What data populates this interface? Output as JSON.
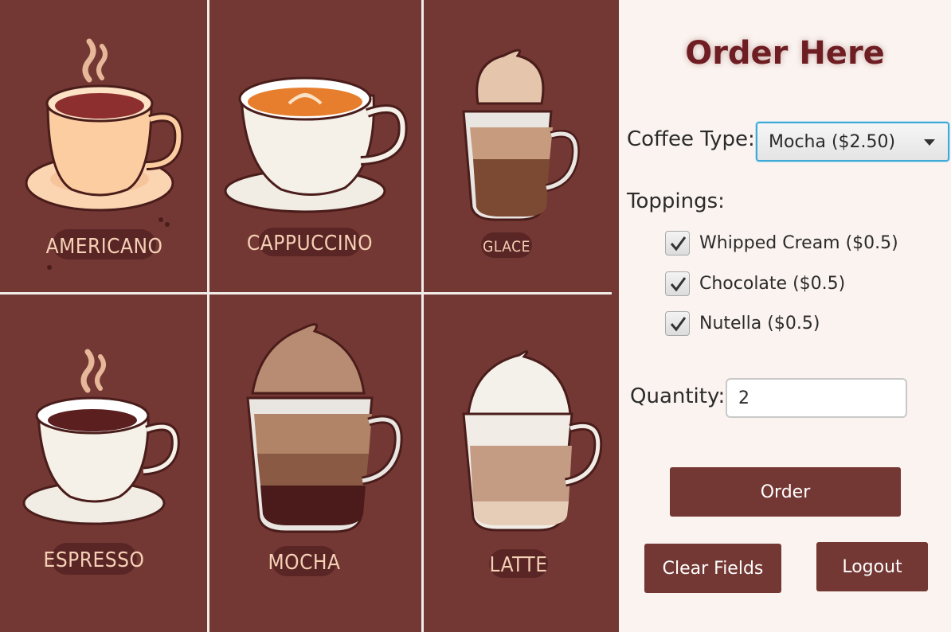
{
  "gallery": {
    "tiles": [
      {
        "name": "Americano",
        "label": "AMERICANO"
      },
      {
        "name": "Cappuccino",
        "label": "CAPPUCCINO"
      },
      {
        "name": "Glace",
        "label": "GLACE"
      },
      {
        "name": "Espresso",
        "label": "ESPRESSO"
      },
      {
        "name": "Mocha",
        "label": "MOCHA"
      },
      {
        "name": "Latte",
        "label": "LATTE"
      }
    ],
    "colors": {
      "background": "#743834",
      "divider": "#f1ece8",
      "label_fill": "#f4d0b5",
      "label_bg": "#5a2525"
    }
  },
  "form": {
    "title": "Order Here",
    "coffee_type_label": "Coffee Type:",
    "coffee_type_selected": "Mocha ($2.50)",
    "toppings_label": "Toppings:",
    "toppings": [
      {
        "label": "Whipped Cream ($0.5)",
        "checked": true
      },
      {
        "label": "Chocolate ($0.5)",
        "checked": true
      },
      {
        "label": "Nutella ($0.5)",
        "checked": true
      }
    ],
    "quantity_label": "Quantity:",
    "quantity_value": "2",
    "buttons": {
      "order": "Order",
      "clear": "Clear Fields",
      "logout": "Logout"
    },
    "colors": {
      "accent": "#743834",
      "title": "#6e1e22",
      "focus": "#3fa9d8",
      "panel_bg": "#faf3ef"
    }
  }
}
